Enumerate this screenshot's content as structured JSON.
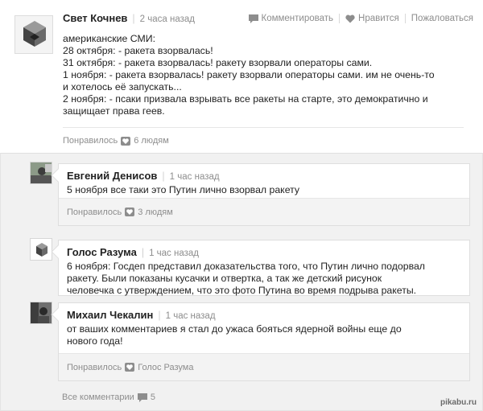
{
  "post": {
    "author": "Свет Кочнев",
    "time": "2 часа назад",
    "actions": {
      "comment": "Комментировать",
      "like": "Нравится",
      "complain": "Пожаловаться"
    },
    "lines": [
      "американские СМИ:",
      "28 октября: - ракета взорвалась!",
      "31 октября: - ракета взорвалась! ракету взорвали операторы сами.",
      "1 ноября: - ракета взорвалась! ракету взорвали операторы сами. им не очень-то",
      "и хотелось её запускать...",
      "2 ноября: - псаки призвала взрывать все ракеты на старте, это демократично и",
      "защищает права геев."
    ],
    "likes_label": "Понравилось",
    "likes_value": "6 людям"
  },
  "comments": [
    {
      "author": "Евгений Денисов",
      "time": "1 час назад",
      "lines": [
        "5 ноября все таки это Путин лично взорвал ракету"
      ],
      "likes_label": "Понравилось",
      "likes_value": "3 людям"
    },
    {
      "author": "Голос Разума",
      "time": "1 час назад",
      "lines": [
        "6 ноября: Госдеп представил доказательства того, что Путин лично подорвал",
        "ракету. Были показаны кусачки и отвертка, а так же детский рисунок",
        "человечка с утверждением, что это фото Путина во время подрыва ракеты."
      ]
    },
    {
      "author": "Михаил Чекалин",
      "time": "1 час назад",
      "lines": [
        "от ваших комментариев я стал до ужаса бояться ядерной войны еще до",
        "нового года!"
      ],
      "likes_label": "Понравилось",
      "likes_value": "Голос Разума"
    }
  ],
  "all_comments": {
    "label": "Все комментарии",
    "count": "5"
  },
  "watermark": "pikabu.ru",
  "colors": {
    "muted": "#8d8d8d",
    "footer_bg": "#f3f3f3",
    "area_bg": "#f1f1f1"
  }
}
